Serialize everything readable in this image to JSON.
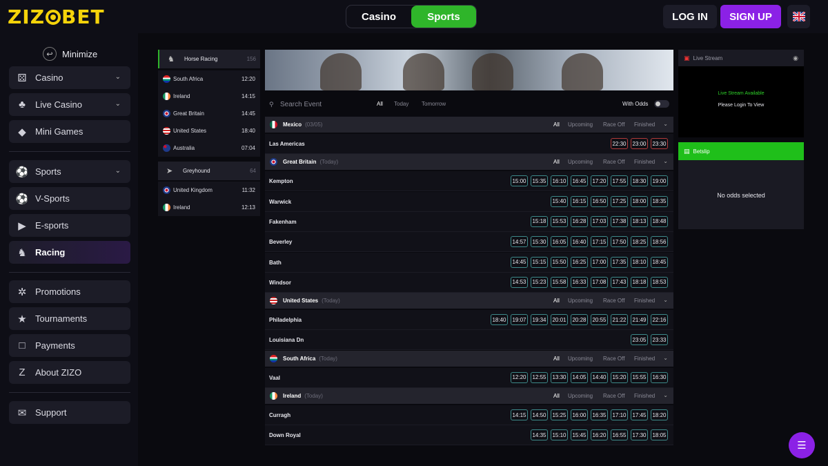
{
  "header": {
    "logo": "ZIZOBET",
    "switch": [
      "Casino",
      "Sports"
    ],
    "active_switch": "Sports",
    "login": "LOG IN",
    "signup": "SIGN UP",
    "lang_icon": "uk-flag-icon"
  },
  "sidebar": {
    "minimize": "Minimize",
    "items": [
      {
        "label": "Casino",
        "icon": "casino-icon"
      },
      {
        "label": "Live Casino",
        "icon": "live-casino-icon"
      },
      {
        "label": "Mini Games",
        "icon": "diamond-icon"
      },
      {
        "label": "Sports",
        "icon": "sports-icon"
      },
      {
        "label": "V-Sports",
        "icon": "vsports-icon"
      },
      {
        "label": "E-sports",
        "icon": "esports-icon"
      },
      {
        "label": "Racing",
        "icon": "horse-icon"
      },
      {
        "label": "Promotions",
        "icon": "megaphone-icon"
      },
      {
        "label": "Tournaments",
        "icon": "trophy-icon"
      },
      {
        "label": "Payments",
        "icon": "wallet-icon"
      },
      {
        "label": "About ZIZO",
        "icon": "z-icon"
      },
      {
        "label": "Support",
        "icon": "chat-icon"
      }
    ]
  },
  "sportlist": {
    "horse": {
      "label": "Horse Racing",
      "count": "156"
    },
    "horse_rows": [
      {
        "country": "South Africa",
        "time": "12:20"
      },
      {
        "country": "Ireland",
        "time": "14:15"
      },
      {
        "country": "Great Britain",
        "time": "14:45"
      },
      {
        "country": "United States",
        "time": "18:40"
      },
      {
        "country": "Australia",
        "time": "07:04"
      }
    ],
    "grey": {
      "label": "Greyhound",
      "count": "64"
    },
    "grey_rows": [
      {
        "country": "United Kingdom",
        "time": "11:32"
      },
      {
        "country": "Ireland",
        "time": "12:13"
      }
    ]
  },
  "search": {
    "placeholder": "Search Event",
    "filters": [
      "All",
      "Today",
      "Tomorrow"
    ],
    "with_odds": "With Odds"
  },
  "group_filters": [
    "All",
    "Upcoming",
    "Race Off",
    "Finished"
  ],
  "groups": [
    {
      "country": "Mexico",
      "date": "(03/05)",
      "tracks": [
        {
          "name": "Las Americas",
          "times": [
            "22:30",
            "23:00",
            "23:30"
          ],
          "red": true
        }
      ]
    },
    {
      "country": "Great Britain",
      "date": "(Today)",
      "tracks": [
        {
          "name": "Kempton",
          "times": [
            "15:00",
            "15:35",
            "16:10",
            "16:45",
            "17:20",
            "17:55",
            "18:30",
            "19:00"
          ]
        },
        {
          "name": "Warwick",
          "times": [
            "15:40",
            "16:15",
            "16:50",
            "17:25",
            "18:00",
            "18:35"
          ]
        },
        {
          "name": "Fakenham",
          "times": [
            "15:18",
            "15:53",
            "16:28",
            "17:03",
            "17:38",
            "18:13",
            "18:48"
          ]
        },
        {
          "name": "Beverley",
          "times": [
            "14:57",
            "15:30",
            "16:05",
            "16:40",
            "17:15",
            "17:50",
            "18:25",
            "18:56"
          ]
        },
        {
          "name": "Bath",
          "times": [
            "14:45",
            "15:15",
            "15:50",
            "16:25",
            "17:00",
            "17:35",
            "18:10",
            "18:45"
          ]
        },
        {
          "name": "Windsor",
          "times": [
            "14:53",
            "15:23",
            "15:58",
            "16:33",
            "17:08",
            "17:43",
            "18:18",
            "18:53"
          ]
        }
      ]
    },
    {
      "country": "United States",
      "date": "(Today)",
      "tracks": [
        {
          "name": "Philadelphia",
          "times": [
            "18:40",
            "19:07",
            "19:34",
            "20:01",
            "20:28",
            "20:55",
            "21:22",
            "21:49",
            "22:16"
          ]
        },
        {
          "name": "Louisiana Dn",
          "times": [
            "23:05",
            "23:33"
          ]
        }
      ]
    },
    {
      "country": "South Africa",
      "date": "(Today)",
      "tracks": [
        {
          "name": "Vaal",
          "times": [
            "12:20",
            "12:55",
            "13:30",
            "14:05",
            "14:40",
            "15:20",
            "15:55",
            "16:30"
          ]
        }
      ]
    },
    {
      "country": "Ireland",
      "date": "(Today)",
      "tracks": [
        {
          "name": "Curragh",
          "times": [
            "14:15",
            "14:50",
            "15:25",
            "16:00",
            "16:35",
            "17:10",
            "17:45",
            "18:20"
          ]
        },
        {
          "name": "Down Royal",
          "times": [
            "14:35",
            "15:10",
            "15:45",
            "16:20",
            "16:55",
            "17:30",
            "18:05"
          ]
        }
      ]
    }
  ],
  "rpanel": {
    "live_stream": "Live Stream",
    "available": "Live Stream Available",
    "login": "Please Login To View",
    "betslip": "Betslip",
    "no_odds": "No odds selected"
  },
  "colors": {
    "accent_green": "#2fb52a",
    "accent_purple": "#8b21e6",
    "logo_yellow": "#f5d30a"
  }
}
